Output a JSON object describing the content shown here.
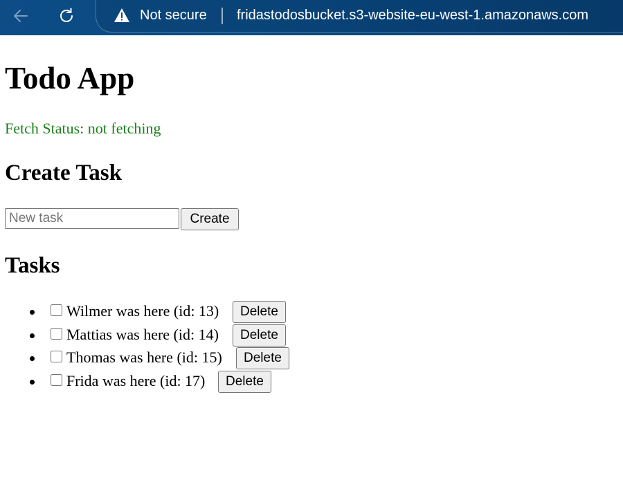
{
  "browser": {
    "security_label": "Not secure",
    "url": "fridastodosbucket.s3-website-eu-west-1.amazonaws.com",
    "icons": [
      "back-arrow-icon",
      "refresh-icon",
      "warning-icon"
    ]
  },
  "page": {
    "title": "Todo App",
    "fetch_status": "Fetch Status: not fetching",
    "create_heading": "Create Task",
    "new_task_placeholder": "New task",
    "create_label": "Create",
    "tasks_heading": "Tasks"
  },
  "tasks": [
    {
      "text": "Wilmer was here (id: 13)",
      "checked": false,
      "delete_label": "Delete"
    },
    {
      "text": "Mattias was here (id: 14)",
      "checked": false,
      "delete_label": "Delete"
    },
    {
      "text": "Thomas was here (id: 15)",
      "checked": false,
      "delete_label": "Delete"
    },
    {
      "text": "Frida was here (id: 17)",
      "checked": false,
      "delete_label": "Delete"
    }
  ],
  "colors": {
    "browser_bar": "#0a4a83",
    "status_green": "#1a7f1a"
  }
}
